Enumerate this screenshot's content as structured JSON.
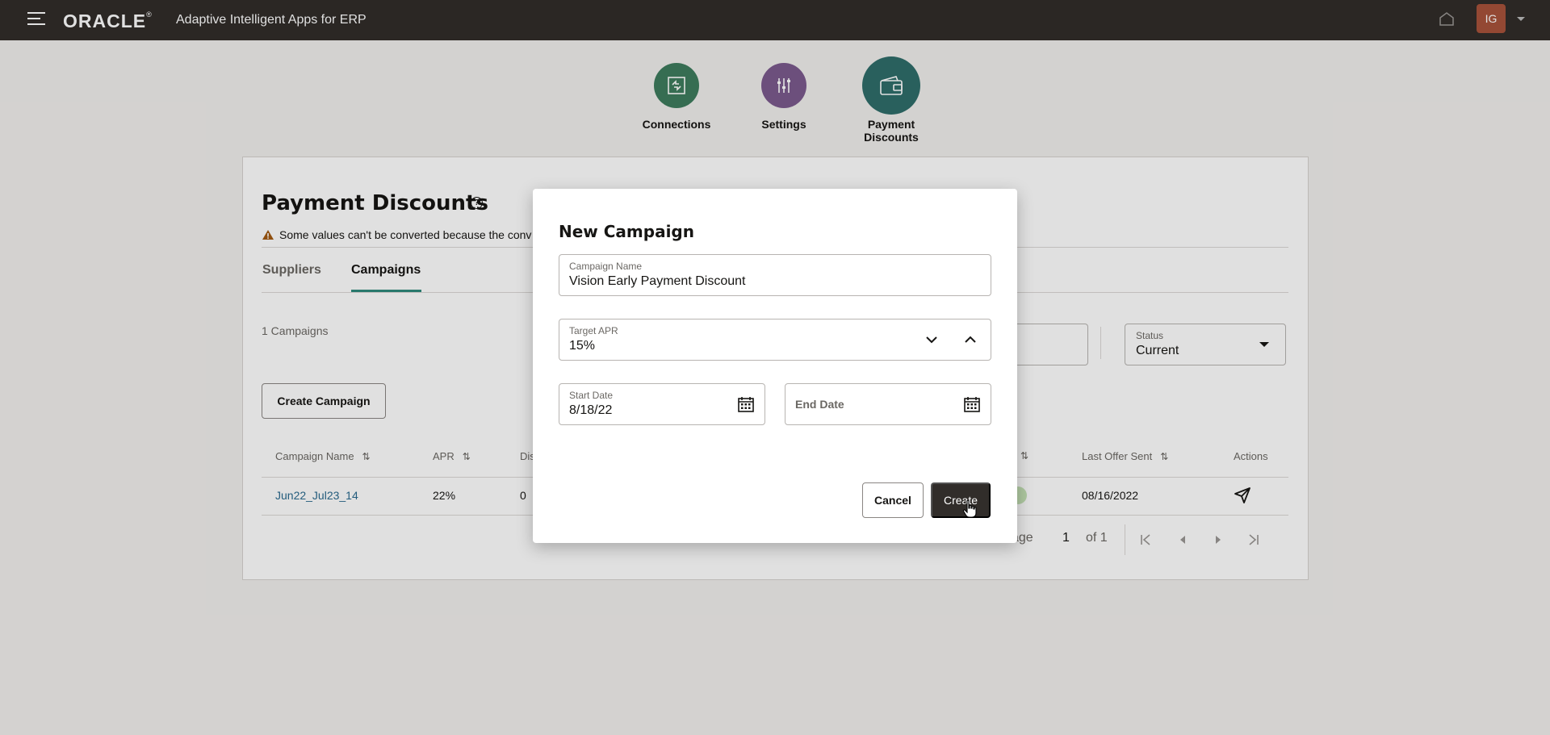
{
  "header": {
    "logo": "ORACLE",
    "app_title": "Adaptive Intelligent Apps for ERP",
    "user_initials": "IG"
  },
  "nav": [
    {
      "label": "Connections",
      "color": "#3e7d5e",
      "icon": "connections-icon"
    },
    {
      "label": "Settings",
      "color": "#7b5b8e",
      "icon": "sliders-icon"
    },
    {
      "label": "Payment Discounts",
      "color": "#2f6e6a",
      "icon": "wallet-icon",
      "selected": true
    }
  ],
  "page": {
    "title": "Payment Discounts",
    "warning_text": "Some values can't be converted because the conv",
    "warning_tail": ":",
    "tabs": [
      "Suppliers",
      "Campaigns"
    ],
    "active_tab": "Campaigns",
    "count_text": "1 Campaigns",
    "status_filter": {
      "label": "Status",
      "value": "Current"
    },
    "create_button": "Create Campaign"
  },
  "table": {
    "columns": [
      "Campaign Name",
      "APR",
      "Dis",
      "Last Offer Sent",
      "Actions"
    ],
    "rows": [
      {
        "campaign_name": "Jun22_Jul23_14",
        "apr": "22%",
        "dis": "0",
        "last_offer_sent": "08/16/2022"
      }
    ]
  },
  "pager": {
    "page_label": "age",
    "current": "1",
    "of_text": "of 1"
  },
  "dialog": {
    "title": "New Campaign",
    "campaign_name": {
      "label": "Campaign Name",
      "value": "Vision Early Payment Discount"
    },
    "target_apr": {
      "label": "Target APR",
      "value": "15%"
    },
    "start_date": {
      "label": "Start Date",
      "value": "8/18/22"
    },
    "end_date": {
      "label": "End Date",
      "value": ""
    },
    "cancel_label": "Cancel",
    "create_label": "Create"
  }
}
